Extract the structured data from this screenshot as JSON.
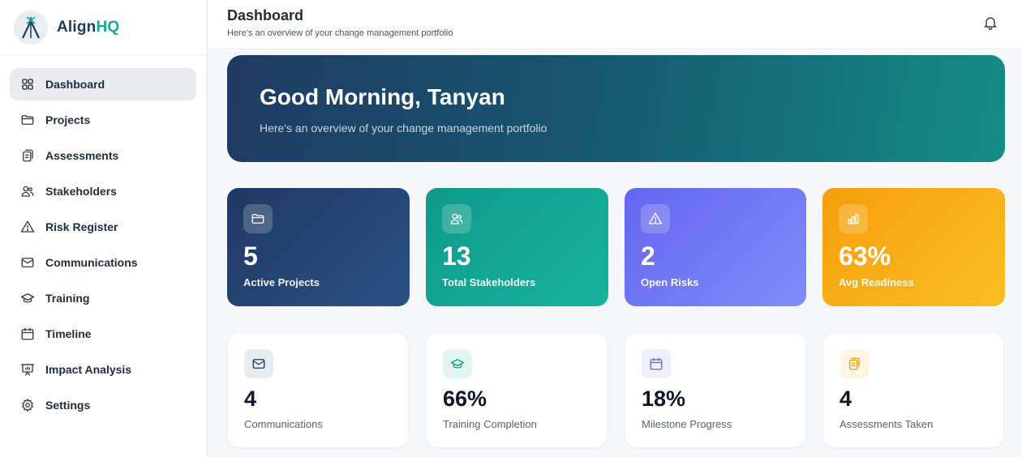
{
  "brand": {
    "name_part1": "Align",
    "name_part2": "HQ"
  },
  "sidebar": {
    "items": [
      {
        "label": "Dashboard",
        "icon": "grid-icon",
        "active": true
      },
      {
        "label": "Projects",
        "icon": "folder-icon"
      },
      {
        "label": "Assessments",
        "icon": "clipboard-icon"
      },
      {
        "label": "Stakeholders",
        "icon": "users-icon"
      },
      {
        "label": "Risk Register",
        "icon": "warning-icon"
      },
      {
        "label": "Communications",
        "icon": "mail-icon"
      },
      {
        "label": "Training",
        "icon": "graduation-cap-icon"
      },
      {
        "label": "Timeline",
        "icon": "calendar-icon"
      },
      {
        "label": "Impact Analysis",
        "icon": "presentation-chart-icon"
      },
      {
        "label": "Settings",
        "icon": "gear-icon"
      }
    ]
  },
  "header": {
    "title": "Dashboard",
    "subtitle": "Here's an overview of your change management portfolio"
  },
  "hero": {
    "greeting": "Good Morning, Tanyan",
    "subtitle": "Here's an overview of your change management portfolio"
  },
  "stats": [
    {
      "value": "5",
      "label": "Active Projects",
      "icon": "folder-icon",
      "color": "#1f3864"
    },
    {
      "value": "13",
      "label": "Total Stakeholders",
      "icon": "users-icon",
      "color": "#0f9a8a"
    },
    {
      "value": "2",
      "label": "Open Risks",
      "icon": "warning-icon",
      "color": "#6366f1"
    },
    {
      "value": "63%",
      "label": "Avg Readiness",
      "icon": "bar-chart-icon",
      "color": "#f59e0b"
    }
  ],
  "metrics": [
    {
      "value": "4",
      "label": "Communications",
      "icon": "mail-icon",
      "color": "#1e3a5f"
    },
    {
      "value": "66%",
      "label": "Training Completion",
      "icon": "graduation-cap-icon",
      "color": "#0f9a8a"
    },
    {
      "value": "18%",
      "label": "Milestone Progress",
      "icon": "calendar-icon",
      "color": "#6366f1"
    },
    {
      "value": "4",
      "label": "Assessments Taken",
      "icon": "clipboard-icon",
      "color": "#f59e0b"
    }
  ],
  "colors": {
    "brand_dark": "#1e3a5f",
    "brand_teal": "#14a896",
    "sidebar_active_bg": "#eaecf0"
  }
}
